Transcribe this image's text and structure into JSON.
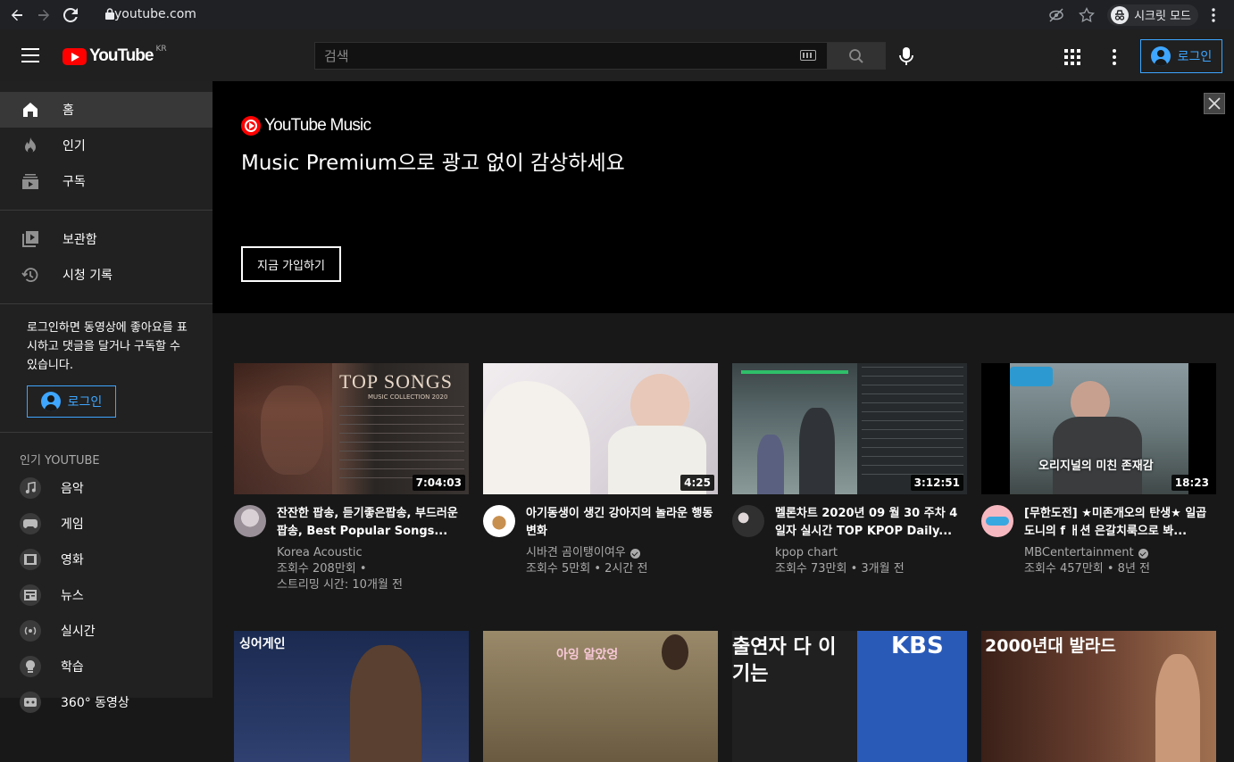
{
  "browser": {
    "url": "youtube.com",
    "incognito_label": "시크릿 모드"
  },
  "header": {
    "logo_text": "YouTube",
    "region": "KR",
    "search_placeholder": "검색",
    "login_label": "로그인"
  },
  "sidebar": {
    "main_items": [
      {
        "label": "홈",
        "icon": "home-icon",
        "active": true
      },
      {
        "label": "인기",
        "icon": "fire-icon"
      },
      {
        "label": "구독",
        "icon": "subscriptions-icon"
      }
    ],
    "library_items": [
      {
        "label": "보관함",
        "icon": "library-icon"
      },
      {
        "label": "시청 기록",
        "icon": "history-icon"
      }
    ],
    "promo_text": "로그인하면 동영상에 좋아요를 표시하고 댓글을 달거나 구독할 수 있습니다.",
    "login_label": "로그인",
    "popular_heading": "인기 YOUTUBE",
    "popular_items": [
      {
        "label": "음악",
        "icon": "music-icon"
      },
      {
        "label": "게임",
        "icon": "gaming-icon"
      },
      {
        "label": "영화",
        "icon": "movie-icon"
      },
      {
        "label": "뉴스",
        "icon": "news-icon"
      },
      {
        "label": "실시간",
        "icon": "live-icon"
      },
      {
        "label": "학습",
        "icon": "learning-icon"
      },
      {
        "label": "360° 동영상",
        "icon": "360-icon"
      }
    ]
  },
  "banner": {
    "logo_text": "YouTube Music",
    "title": "Music Premium으로 광고 없이 감상하세요",
    "cta_label": "지금 가입하기"
  },
  "videos": [
    {
      "title": "잔잔한 팝송, 듣기좋은팝송, 부드러운 팝송, Best Popular Songs...",
      "channel": "Korea Acoustic",
      "verified": false,
      "stats_line1": "조회수 208만회 •",
      "stats_line2": "스트리밍 시간: 10개월 전",
      "duration": "7:04:03",
      "thumb_text": "TOP SONGS",
      "thumb_subtext": "MUSIC COLLECTION 2020",
      "thumb_color": "#5a3a30"
    },
    {
      "title": "아기동생이 생긴 강아지의 놀라운 행동변화",
      "channel": "시바견 곰이탱이여우",
      "verified": true,
      "stats_line1": "조회수 5만회 • 2시간 전",
      "stats_line2": "",
      "duration": "4:25",
      "thumb_color": "#e8e4e6"
    },
    {
      "title": "멜론차트 2020년 09 월 30 주차 4 일자 실시간 TOP KPOP Daily...",
      "channel": "kpop chart",
      "verified": false,
      "stats_line1": "조회수 73만회 • 3개월 전",
      "stats_line2": "",
      "duration": "3:12:51",
      "thumb_color": "#2a2e30"
    },
    {
      "title": "[무한도전] ★미존개오의 탄생★ 일곱 도니의 f ㅐ션 은갈치룩으로 봐...",
      "channel": "MBCentertainment",
      "verified": true,
      "stats_line1": "조회수 457만회 • 8년 전",
      "stats_line2": "",
      "duration": "18:23",
      "thumb_text": "오리지널의 미친 존재감",
      "thumb_color": "#6a7a80"
    },
    {
      "title": "",
      "thumb_text": "싱어게인",
      "thumb_color": "#1a2a50"
    },
    {
      "title": "",
      "thumb_text": "아잉 알았엉",
      "thumb_color": "#8a7050"
    },
    {
      "title": "",
      "thumb_text": "출연자 다 이기는",
      "thumb_subtext": "KBS",
      "thumb_color": "#202020"
    },
    {
      "title": "",
      "thumb_text": "2000년대 발라드",
      "thumb_color": "#4a2a20"
    }
  ]
}
